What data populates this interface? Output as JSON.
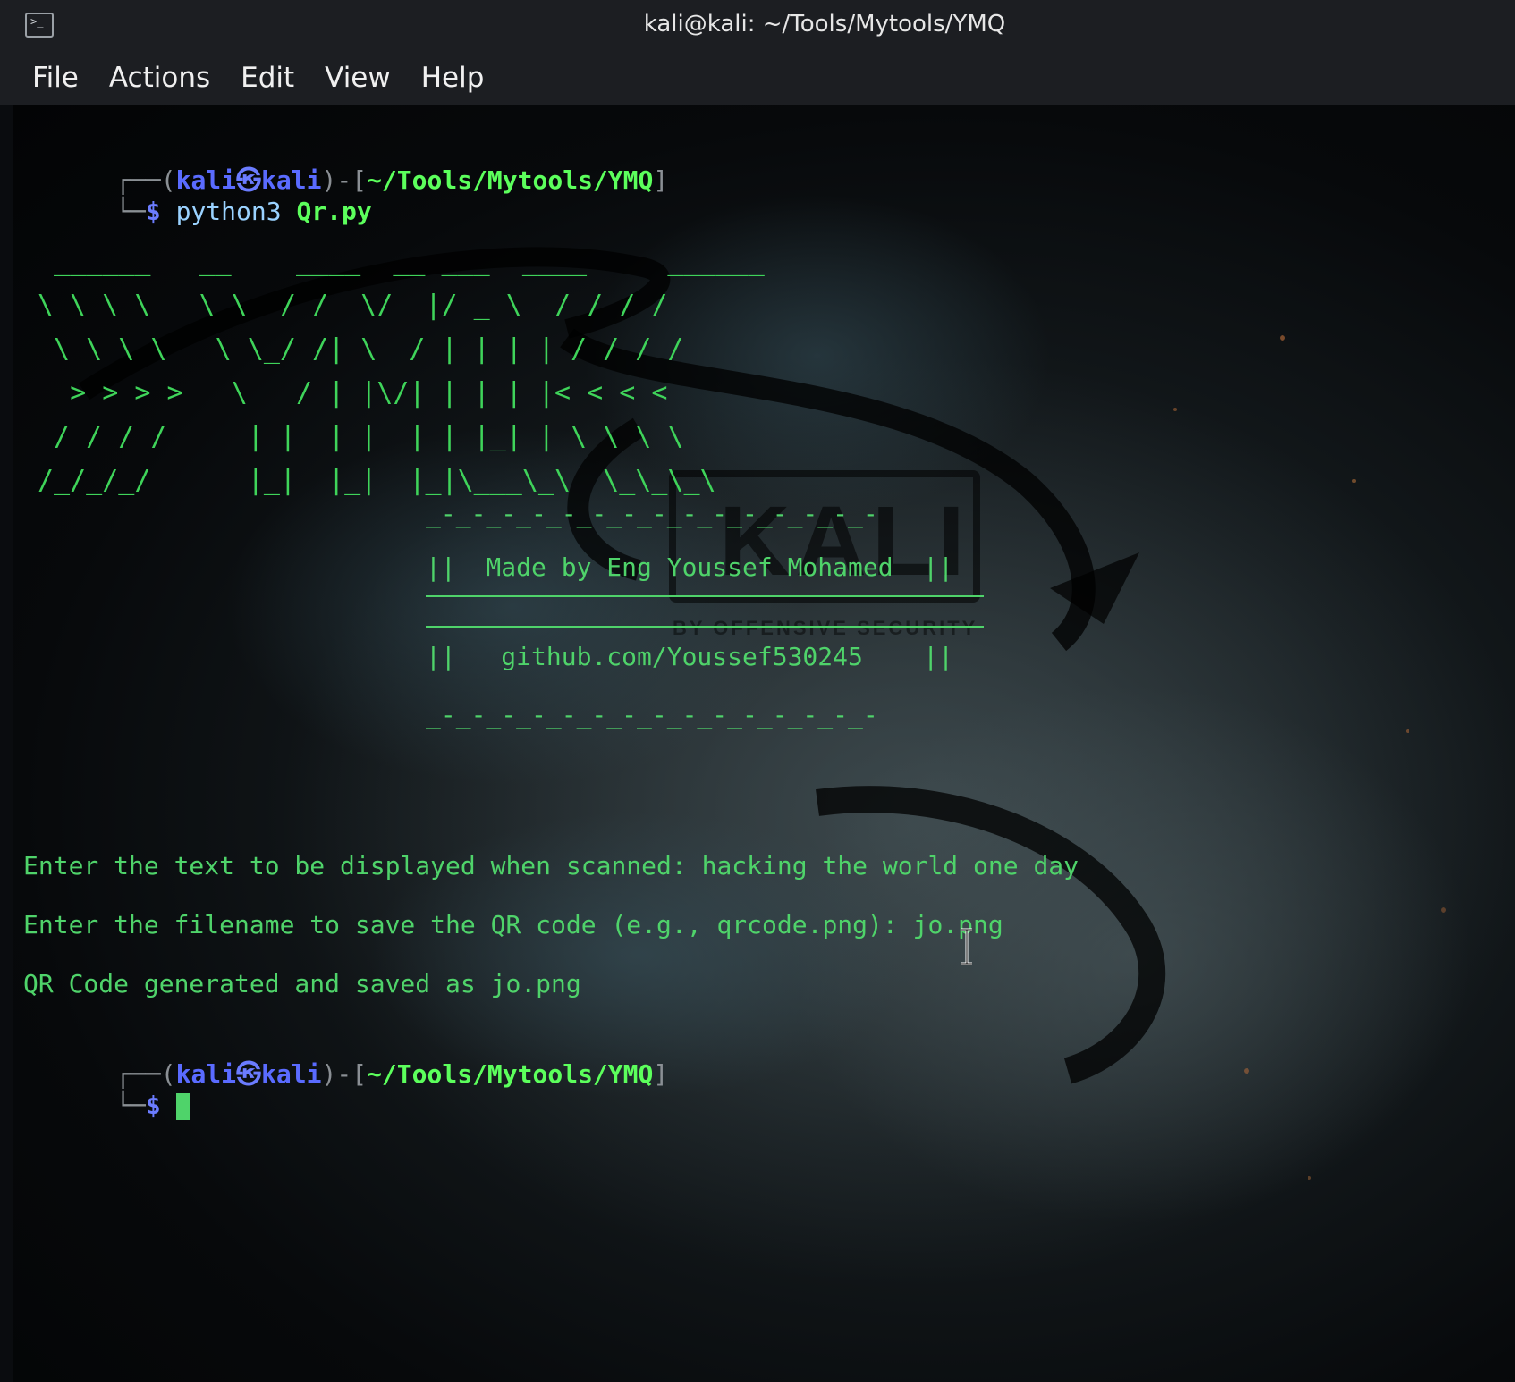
{
  "window": {
    "title": "kali@kali: ~/Tools/Mytools/YMQ"
  },
  "menu": {
    "items": [
      "File",
      "Actions",
      "Edit",
      "View",
      "Help"
    ]
  },
  "prompt1": {
    "frame_top": "┌──(",
    "user": "kali",
    "at": "㉿",
    "host": "kali",
    "mid": ")-[",
    "path": "~/Tools/Mytools/YMQ",
    "end": "]",
    "frame_bottom": "└─",
    "dollar": "$",
    "command": "python3",
    "arg": "Qr.py"
  },
  "ascii_art": " ______   __    ____  __ ___  ____     ______\n\\ \\ \\ \\   \\ \\  / /  \\/  |/ _ \\  / / / /\n \\ \\ \\ \\   \\ \\_/ /| \\  / | | | | / / / /\n  > > > >   \\   / | |\\/| | | | |< < < <\n / / / /     | |  | |  | | |_| | \\ \\ \\ \\\n/_/_/_/      |_|  |_|  |_|\\___\\_\\  \\_\\_\\_\\",
  "banner": {
    "dashes_top": "_-_-_-_-_-_-_-_-_-_-_-_-_-_-_-",
    "line1": "||  Made by Eng Youssef Mohamed  ||",
    "line2": "||   github.com/Youssef530245    ||",
    "dashes_bottom": "_-_-_-_-_-_-_-_-_-_-_-_-_-_-_-"
  },
  "output": {
    "line1": "Enter the text to be displayed when scanned: hacking the world one day",
    "line2": "Enter the filename to save the QR code (e.g., qrcode.png): jo.png",
    "line3": "QR Code generated and saved as jo.png"
  },
  "prompt2": {
    "frame_top": "┌──(",
    "user": "kali",
    "at": "㉿",
    "host": "kali",
    "mid": ")-[",
    "path": "~/Tools/Mytools/YMQ",
    "end": "]",
    "frame_bottom": "└─",
    "dollar": "$"
  },
  "background": {
    "logo_text": "KALI",
    "logo_subtext": "BY OFFENSIVE SECURITY"
  },
  "colors": {
    "terminal_green": "#4fd36a",
    "prompt_blue": "#5a6bff",
    "path_green": "#5cff5c",
    "titlebar_bg": "#1c1e22"
  }
}
